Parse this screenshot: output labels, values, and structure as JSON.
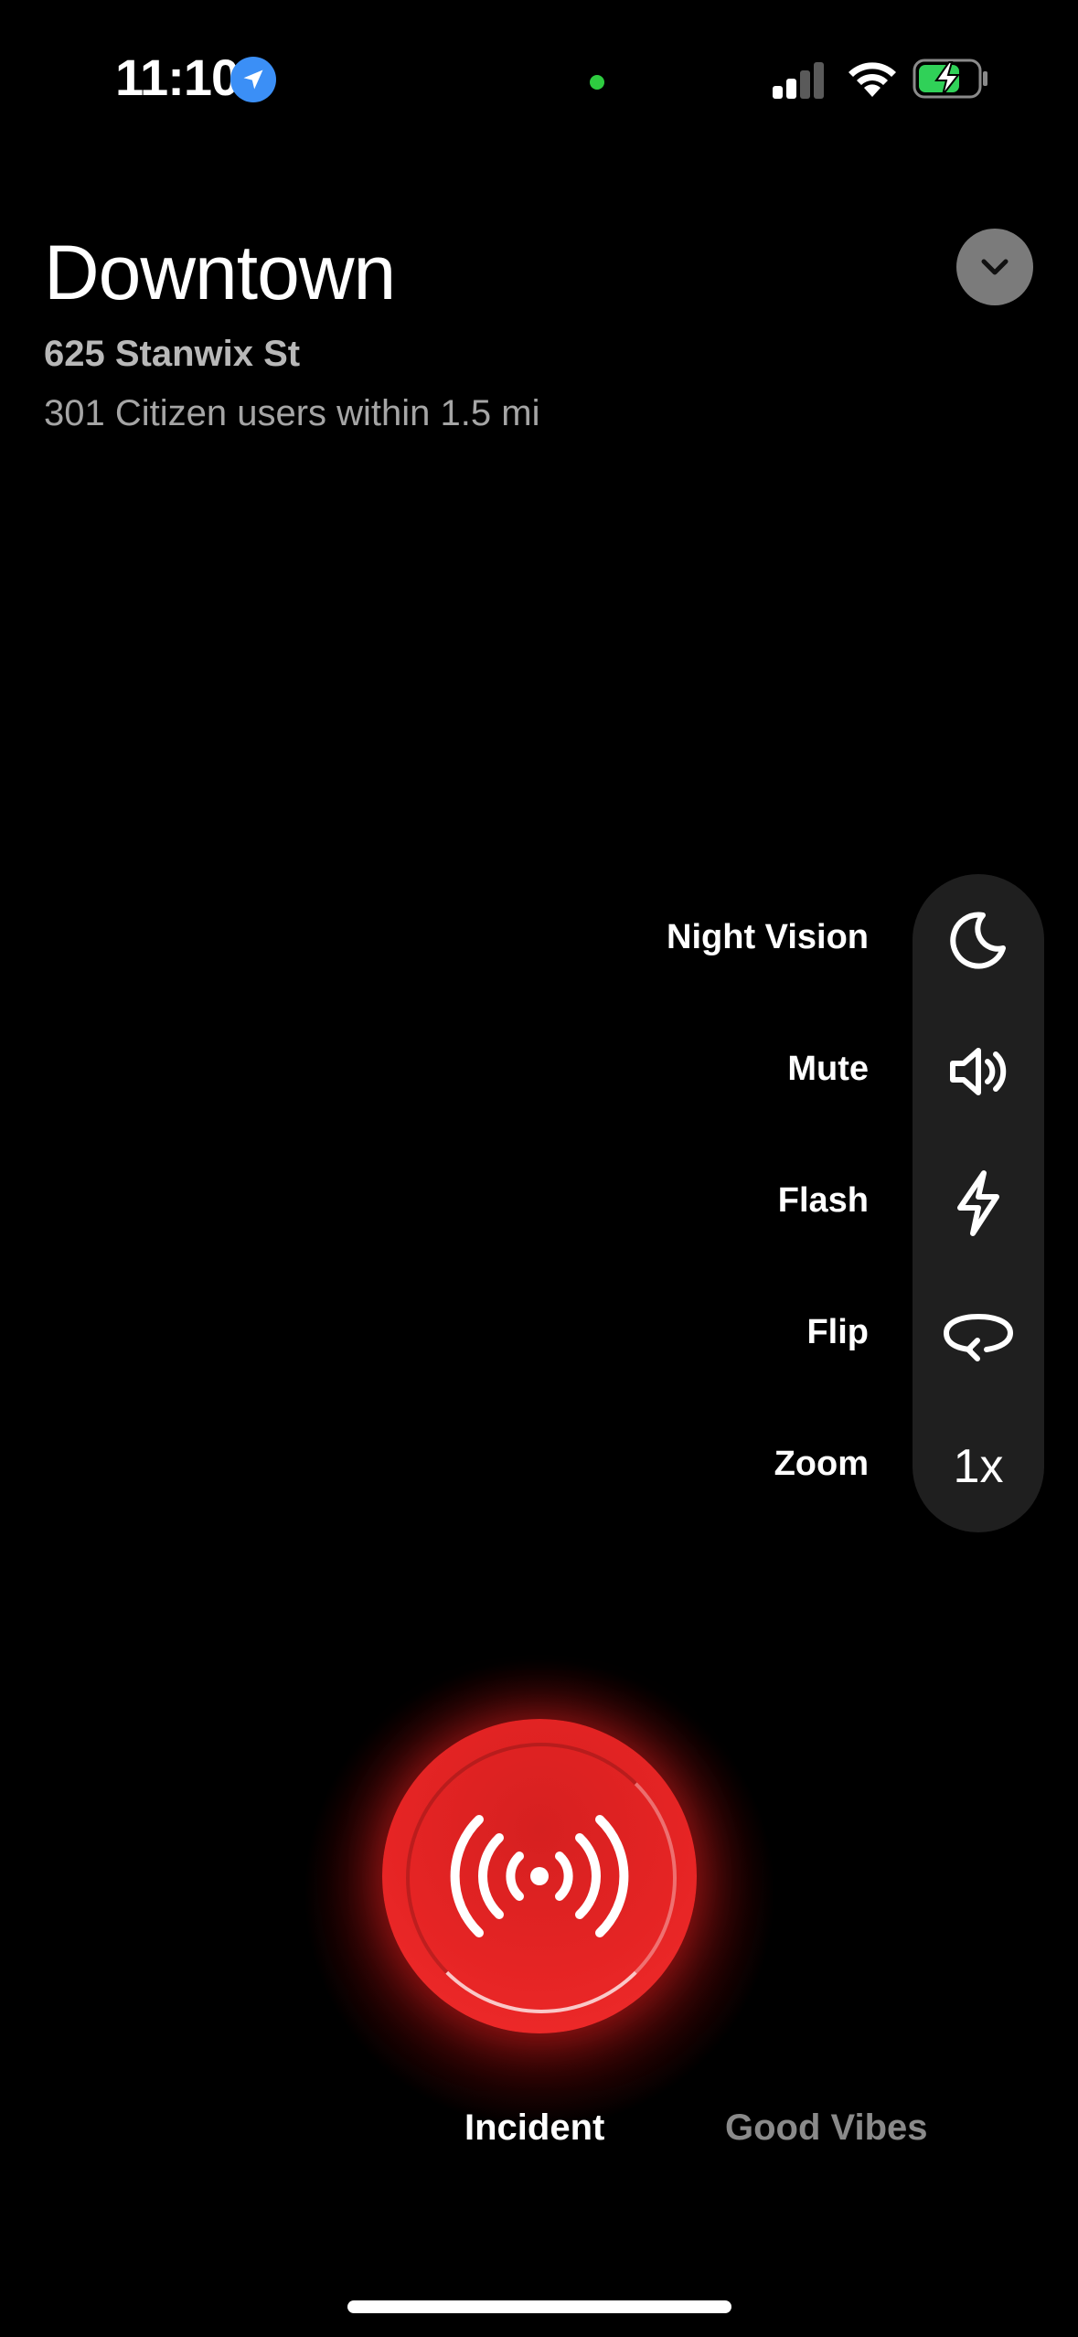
{
  "status_bar": {
    "time": "11:10",
    "icons": [
      "location-arrow-icon",
      "camera-in-use-dot",
      "cellular-signal-icon",
      "wifi-icon",
      "battery-charging-icon"
    ]
  },
  "header": {
    "title": "Downtown",
    "address": "625 Stanwix St",
    "users_text": "301 Citizen users within 1.5 mi",
    "collapse_icon": "chevron-down-icon"
  },
  "controls": [
    {
      "label": "Night Vision",
      "icon": "moon-icon"
    },
    {
      "label": "Mute",
      "icon": "speaker-icon"
    },
    {
      "label": "Flash",
      "icon": "lightning-icon"
    },
    {
      "label": "Flip",
      "icon": "flip-camera-icon"
    },
    {
      "label": "Zoom",
      "value": "1x"
    }
  ],
  "record": {
    "icon": "broadcast-icon",
    "color": "#e52424"
  },
  "modes": {
    "active": "Incident",
    "inactive": "Good Vibes"
  }
}
